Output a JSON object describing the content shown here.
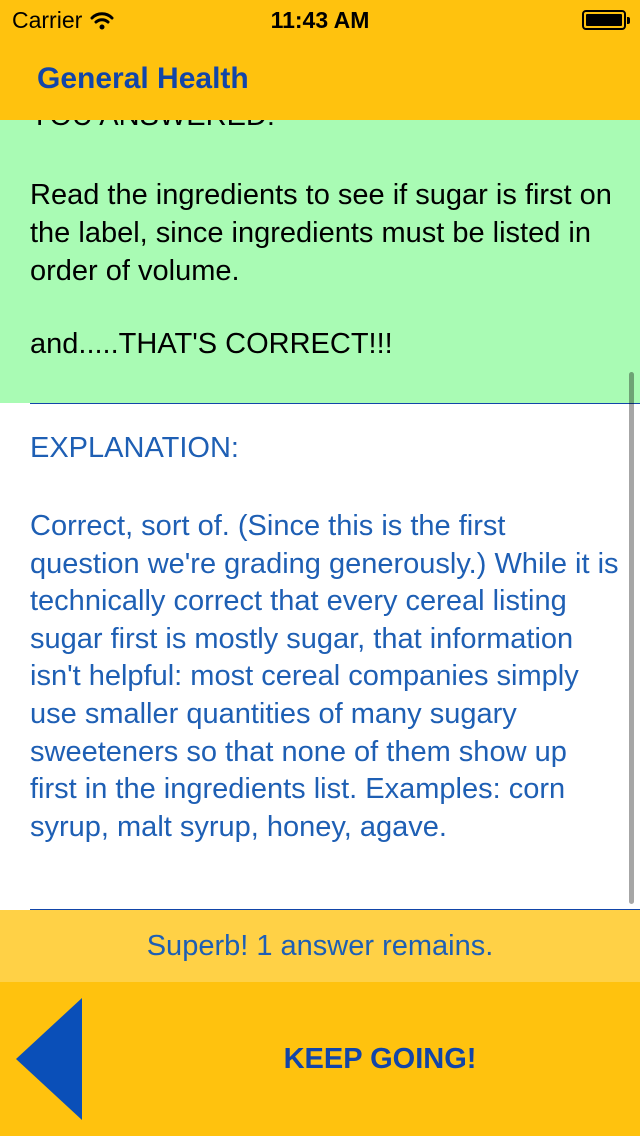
{
  "status_bar": {
    "carrier": "Carrier",
    "time": "11:43 AM",
    "wifi_icon": "wifi-icon",
    "battery_icon": "battery-full-icon"
  },
  "nav": {
    "title": "General Health"
  },
  "answer": {
    "heading": "YOU ANSWERED:",
    "text": "Read the ingredients to see if sugar is first on the label, since ingredients must be listed in order of volume.",
    "verdict": "and.....THAT'S CORRECT!!!"
  },
  "explanation": {
    "heading": "EXPLANATION:",
    "text": "Correct, sort of.  (Since this is the first question we're grading generously.)  While it is technically correct that every cereal listing sugar first is mostly sugar, that information isn't helpful:  most cereal companies simply use smaller quantities of many sugary sweeteners so that none of them show up first in the ingredients list. Examples: corn syrup, malt syrup, honey, agave."
  },
  "banner": {
    "text": "Superb! 1 answer remains."
  },
  "footer": {
    "back_icon": "back-arrow-icon",
    "keep_going_label": "KEEP GOING!"
  },
  "colors": {
    "header_yellow": "#FFC20E",
    "banner_yellow": "#FFD146",
    "answer_green": "#A9FBB4",
    "title_blue": "#1245A8",
    "text_blue": "#1E5FB4",
    "arrow_blue": "#0A4FB8"
  }
}
